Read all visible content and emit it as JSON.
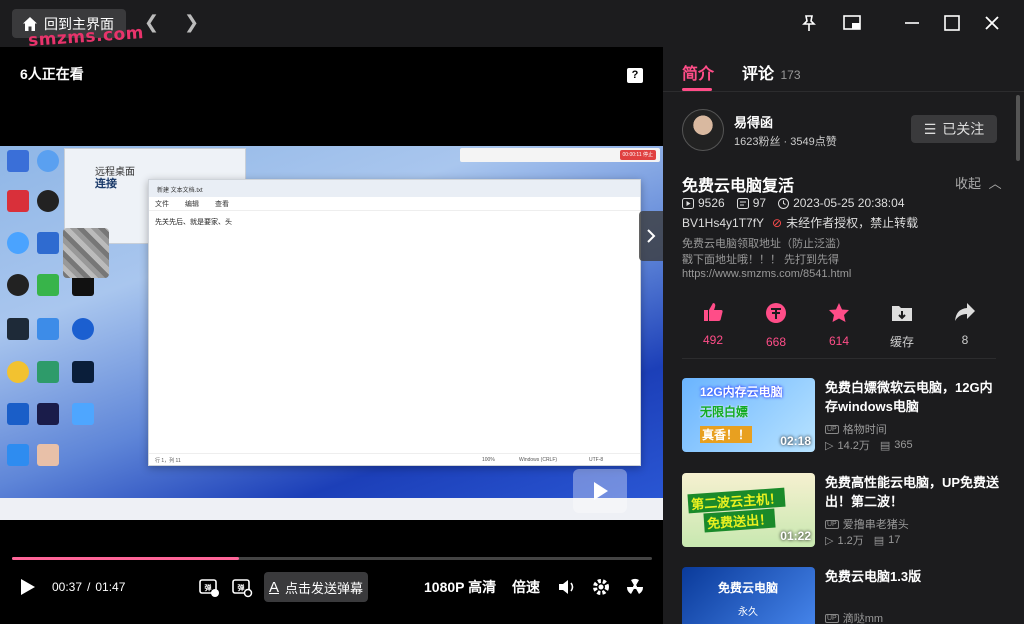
{
  "titlebar": {
    "home_label": "回到主界面",
    "watermark": "smzms.com"
  },
  "player": {
    "viewers": "6人正在看",
    "progress_fraction": 0.355,
    "current_time": "00:37",
    "total_time": "01:47",
    "danmu_placeholder": "点击发送弹幕",
    "quality": "1080P 高清",
    "speed": "倍速",
    "video": {
      "notepad_title": "新建 文本文档.txt",
      "notepad_menu": [
        "文件",
        "编辑",
        "查看"
      ],
      "notepad_text": "先关先后、就是要家、头",
      "rd_title": "远程桌面",
      "rd_subtitle": "连接",
      "status_left": "行 1，列 11",
      "status_zoom": "100%",
      "status_eol": "Windows (CRLF)",
      "status_enc": "UTF-8",
      "toolbar_badge": "00:00:11 停止"
    }
  },
  "sidebar": {
    "tabs": [
      {
        "label": "简介",
        "active": true
      },
      {
        "label": "评论",
        "count": "173",
        "active": false
      }
    ],
    "uploader": {
      "name": "易得函",
      "stats": "1623粉丝 · 3549点赞",
      "follow_label": "已关注"
    },
    "video": {
      "title": "免费云电脑复活",
      "collapse_label": "收起",
      "views": "9526",
      "danmaku": "97",
      "date": "2023-05-25 20:38:04",
      "bvid": "BV1Hs4y1T7fY",
      "reprint_notice": "未经作者授权，禁止转载",
      "desc_lines": [
        "免费云电脑领取地址（防止泛滥）",
        "戳下面地址哦！！！ 先打到先得",
        "https://www.smzms.com/8541.html"
      ]
    },
    "actions": [
      {
        "icon": "thumbs-up-icon",
        "count": "492"
      },
      {
        "icon": "coin-icon",
        "count": "668"
      },
      {
        "icon": "star-icon",
        "count": "614"
      },
      {
        "icon": "download-icon",
        "count": "缓存"
      },
      {
        "icon": "share-icon",
        "count": "8"
      }
    ],
    "recommendations": [
      {
        "title": "免费白嫖微软云电脑，12G内存windows电脑",
        "up": "格物时间",
        "views": "14.2万",
        "danmaku": "365",
        "duration": "02:18",
        "thumb_line1": "12G内存云电脑",
        "thumb_line2": "无限白嫖",
        "thumb_line3": "真香！！"
      },
      {
        "title": "免费高性能云电脑，UP免费送出！第二波！",
        "up": "爱撸串老猪头",
        "views": "1.2万",
        "danmaku": "17",
        "duration": "01:22",
        "thumb_line1": "第二波云主机！",
        "thumb_line2": "免费送出！"
      },
      {
        "title": "免费云电脑1.3版",
        "up": "滴哒mm",
        "thumb_line1": "免费云电脑",
        "thumb_line2": "永久"
      }
    ]
  },
  "colors": {
    "accent": "#ff4d88",
    "progress": "#ff6699",
    "background": "#1c1c1e"
  }
}
